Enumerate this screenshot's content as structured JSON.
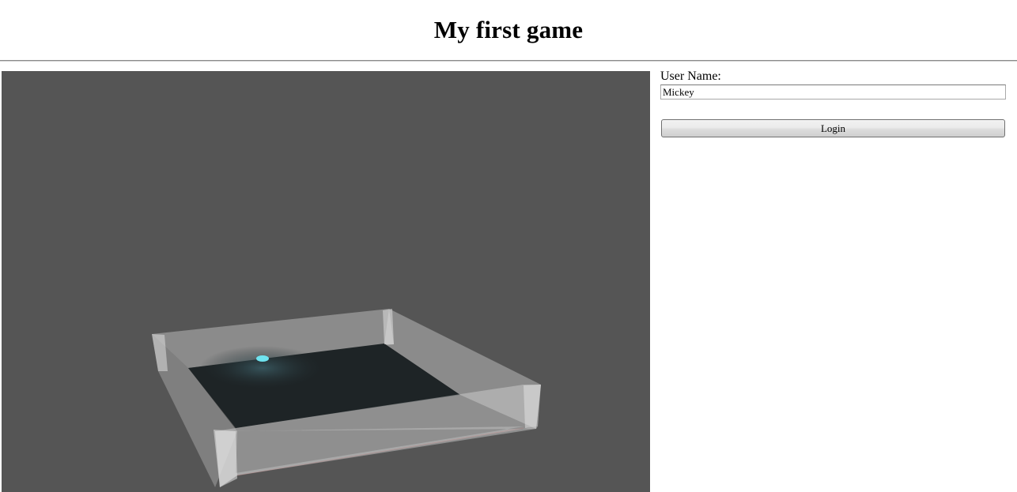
{
  "header": {
    "title": "My first game"
  },
  "login": {
    "label": "User Name:",
    "username_value": "Mickey",
    "button_label": "Login"
  },
  "scene": {
    "background_color": "#555555",
    "floor_color": "#1e2426",
    "glass_color": "#d8d8d8",
    "ball_color": "#6fe3ef"
  }
}
